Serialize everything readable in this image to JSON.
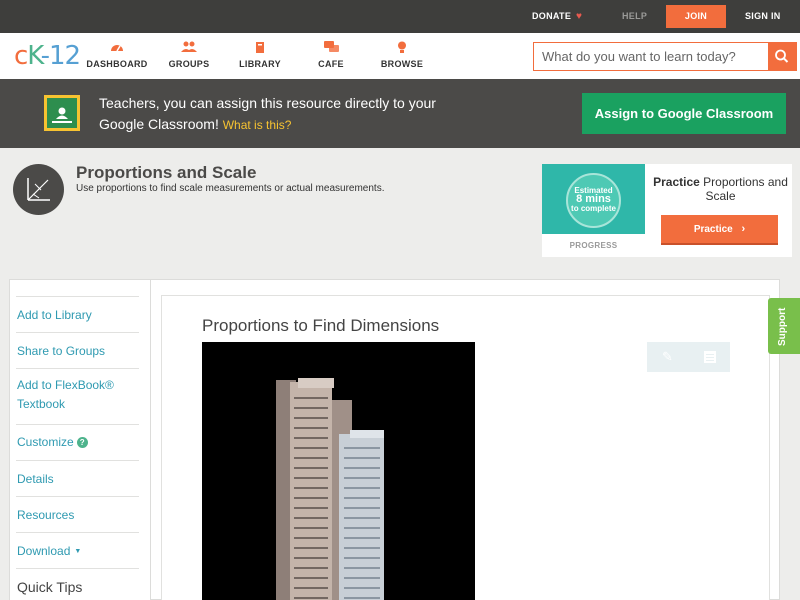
{
  "topbar": {
    "donate": "DONATE",
    "help": "HELP",
    "join": "JOIN",
    "signin": "SIGN IN"
  },
  "logo": {
    "c": "c",
    "k": "K",
    "n": "-12"
  },
  "nav": {
    "items": [
      {
        "label": "DASHBOARD",
        "icon": "dashboard-icon"
      },
      {
        "label": "GROUPS",
        "icon": "groups-icon"
      },
      {
        "label": "LIBRARY",
        "icon": "library-icon"
      },
      {
        "label": "CAFE",
        "icon": "cafe-icon"
      },
      {
        "label": "BROWSE",
        "icon": "browse-icon"
      }
    ],
    "search_placeholder": "What do you want to learn today?"
  },
  "banner": {
    "text": "Teachers, you can assign this resource directly to your Google Classroom!",
    "link": "What is this?",
    "button": "Assign to Google Classroom"
  },
  "header": {
    "title": "Proportions and Scale",
    "subtitle": "Use proportions to find scale measurements or actual measurements."
  },
  "practice": {
    "estimated": "Estimated",
    "mins": "8 mins",
    "complete": "to complete",
    "progress": "PROGRESS",
    "title_bold": "Practice",
    "title_rest": "Proportions and Scale",
    "button": "Practice"
  },
  "sidebar": {
    "items": [
      {
        "label": "Add to Library"
      },
      {
        "label": "Share to Groups"
      },
      {
        "label": "Add to FlexBook® Textbook"
      },
      {
        "label": "Customize"
      },
      {
        "label": "Details"
      },
      {
        "label": "Resources"
      },
      {
        "label": "Download"
      },
      {
        "label": "Quick Tips"
      }
    ]
  },
  "article": {
    "title": "Proportions to Find Dimensions"
  },
  "support": "Support",
  "colors": {
    "accent": "#f26d3d",
    "green": "#1aa160",
    "link": "#2f9ab1"
  }
}
